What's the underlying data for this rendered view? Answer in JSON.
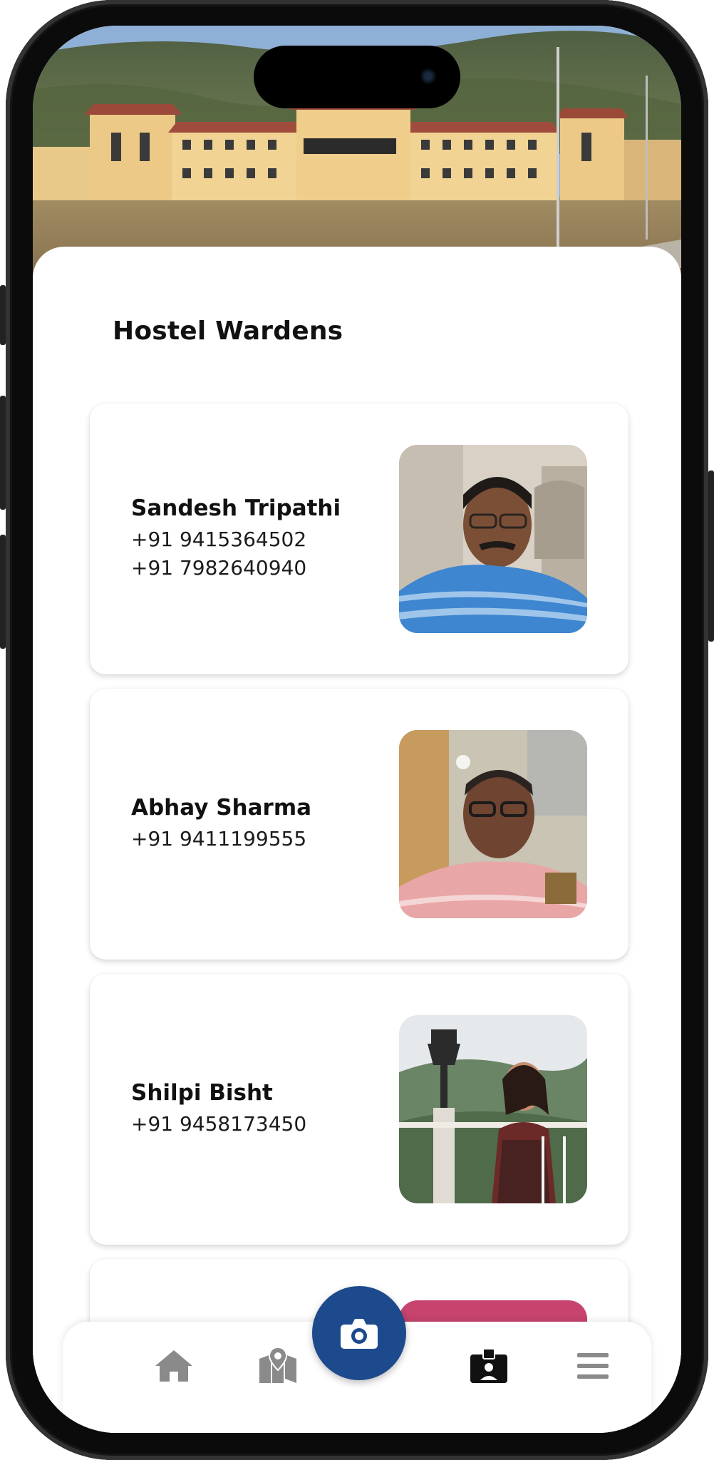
{
  "section_title": "Hostel Wardens",
  "wardens": [
    {
      "name": "Sandesh Tripathi",
      "phones": [
        "+91 9415364502",
        "+91 7982640940"
      ]
    },
    {
      "name": "Abhay Sharma",
      "phones": [
        "+91 9411199555"
      ]
    },
    {
      "name": "Shilpi Bisht",
      "phones": [
        "+91 9458173450"
      ]
    },
    {
      "name": "",
      "phones": []
    }
  ],
  "nav": {
    "items": [
      {
        "icon": "home-icon",
        "active": false
      },
      {
        "icon": "map-icon",
        "active": false
      },
      {
        "icon": "camera-icon",
        "active": false
      },
      {
        "icon": "id-badge-icon",
        "active": true
      },
      {
        "icon": "menu-icon",
        "active": false
      }
    ]
  },
  "colors": {
    "accent": "#1c4a8c",
    "nav_inactive": "#8a8a8a",
    "nav_active": "#111111"
  }
}
